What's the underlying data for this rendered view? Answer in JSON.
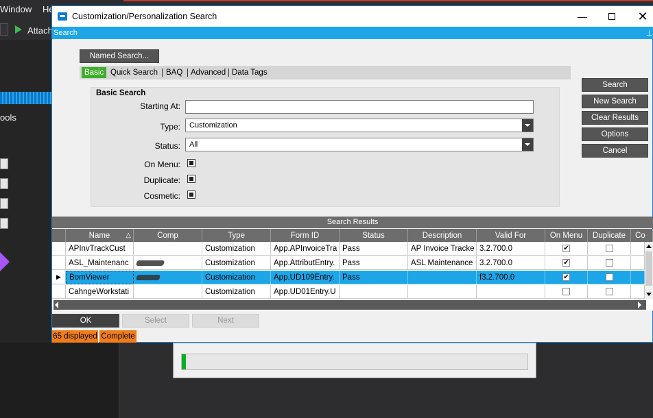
{
  "background": {
    "menu_window": "Window",
    "menu_help": "He",
    "attach_label": "Attach",
    "tools_label": "ools"
  },
  "dialog": {
    "title": "Customization/Personalization Search",
    "pane_title": "Search",
    "named_search_label": "Named Search...",
    "tabs": [
      {
        "label": "Basic",
        "active": true
      },
      {
        "label": "Quick Search",
        "active": false
      },
      {
        "label": "BAQ",
        "active": false
      },
      {
        "label": "Advanced",
        "active": false
      },
      {
        "label": "Data Tags",
        "active": false
      }
    ],
    "basic_search": {
      "group_title": "Basic Search",
      "starting_at_label": "Starting At:",
      "starting_at_value": "",
      "type_label": "Type:",
      "type_value": "Customization",
      "status_label": "Status:",
      "status_value": "All",
      "on_menu_label": "On Menu:",
      "duplicate_label": "Duplicate:",
      "cosmetic_label": "Cosmetic:"
    },
    "side_buttons": {
      "search": "Search",
      "new_search": "New Search",
      "clear_results": "Clear Results",
      "options": "Options",
      "cancel": "Cancel"
    },
    "results": {
      "header": "Search Results",
      "columns": [
        "Name",
        "Comp",
        "Type",
        "Form ID",
        "Status",
        "Description",
        "Valid For",
        "On Menu",
        "Duplicate",
        "Co"
      ],
      "rows": [
        {
          "name": "APInvTrackCust",
          "comp": "",
          "type": "Customization",
          "form_id": "App.APInvoiceTra",
          "status": "Pass",
          "description": "AP Invoice Tracke",
          "valid_for": "3.2.700.0",
          "on_menu": true,
          "duplicate": false,
          "selected": false
        },
        {
          "name": "ASL_Maintenanc",
          "comp": "",
          "type": "Customization",
          "form_id": "App.AttributEntry.",
          "status": "Pass",
          "description": "ASL Maintenance",
          "valid_for": "3.2.700.0",
          "on_menu": true,
          "duplicate": false,
          "selected": false
        },
        {
          "name": "BomViewer",
          "comp": "",
          "type": "Customization",
          "form_id": "App.UD109Entry.",
          "status": "Pass",
          "description": "",
          "valid_for": "f3.2.700.0",
          "on_menu": true,
          "duplicate": false,
          "selected": true
        },
        {
          "name": "CahngeWorkstati",
          "comp": "",
          "type": "Customization",
          "form_id": "App.UD01Entry.U",
          "status": "",
          "description": "",
          "valid_for": "",
          "on_menu": false,
          "duplicate": false,
          "selected": false
        }
      ]
    },
    "footer": {
      "ok": "OK",
      "select": "Select",
      "next": "Next",
      "count_text": "65 displayed",
      "state_text": "Complete"
    }
  },
  "colors": {
    "accent_blue": "#1ca6e8",
    "tab_active_green": "#3fae2a",
    "status_orange": "#f07d1a",
    "button_dark": "#555555"
  }
}
